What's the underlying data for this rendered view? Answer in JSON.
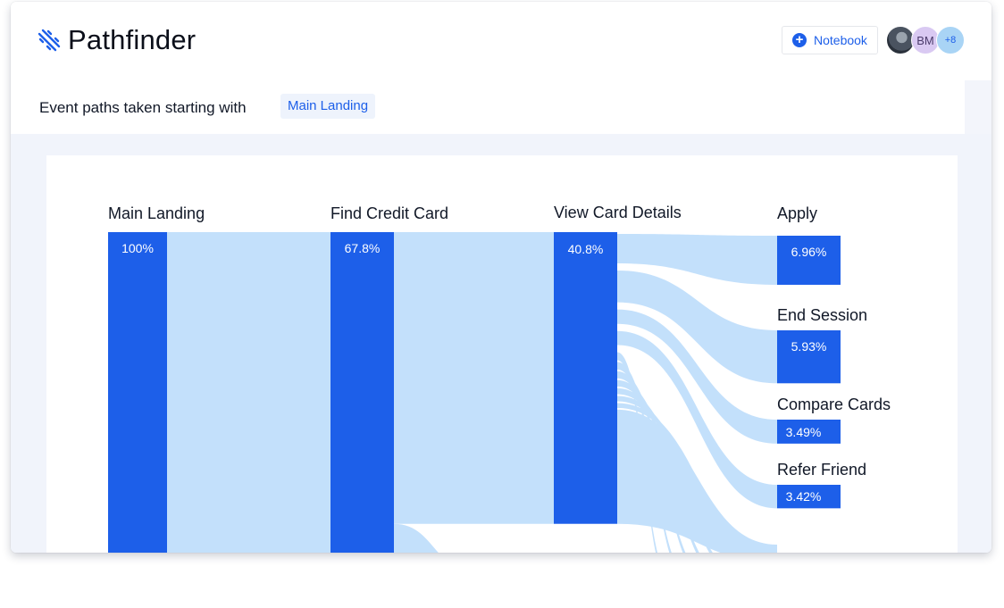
{
  "header": {
    "app_title": "Pathfinder",
    "notebook_label": "Notebook",
    "avatars": {
      "initials": "BM",
      "more": "+8"
    }
  },
  "subtitle": {
    "text": "Event  paths taken starting with",
    "chip": "Main Landing"
  },
  "colors": {
    "node": "#1d5fe9",
    "flow": "#c3e0fb",
    "accent": "#1d5fe9"
  },
  "chart_data": {
    "type": "sankey",
    "steps": [
      {
        "name": "Main Landing",
        "value": 100,
        "label": "100%"
      },
      {
        "name": "Find Credit Card",
        "value": 67.8,
        "label": "67.8%"
      },
      {
        "name": "View Card Details",
        "value": 40.8,
        "label": "40.8%"
      }
    ],
    "outcomes": [
      {
        "name": "Apply",
        "value": 6.96,
        "label": "6.96%"
      },
      {
        "name": "End Session",
        "value": 5.93,
        "label": "5.93%"
      },
      {
        "name": "Compare Cards",
        "value": 3.49,
        "label": "3.49%"
      },
      {
        "name": "Refer Friend",
        "value": 3.42,
        "label": "3.42%"
      }
    ]
  }
}
